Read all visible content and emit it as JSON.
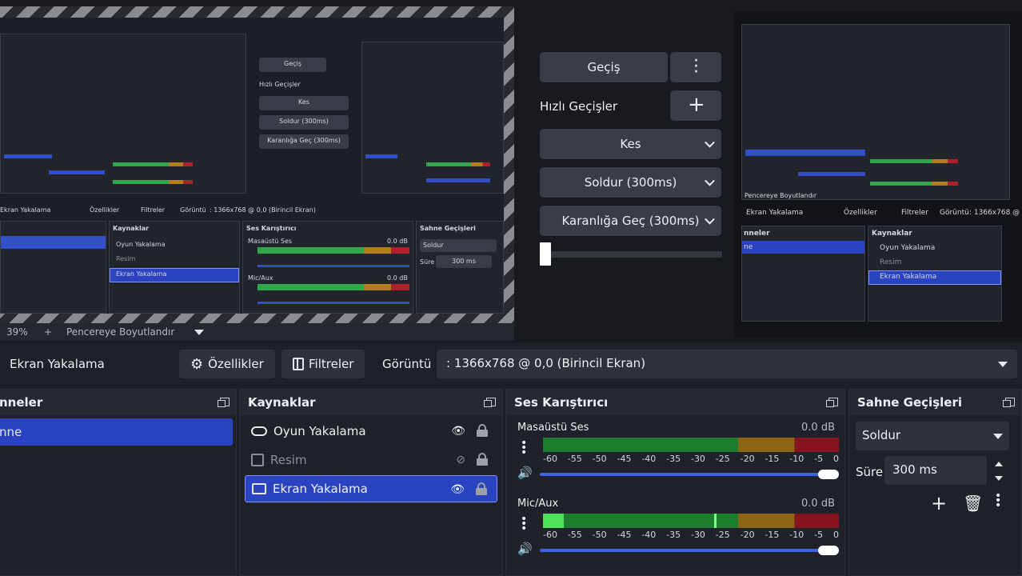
{
  "preview": {
    "zoom_label": "39%",
    "zoom_plus": "+",
    "resize_label": "Pencereye Boyutlandır",
    "mini": {
      "transition_label": "Geçiş",
      "quick_label": "Hızlı Geçişler",
      "cut": "Kes",
      "fade": "Soldur (300ms)",
      "fade_black": "Karanlığa Geç (300ms)",
      "source": "Ekran Yakalama",
      "properties": "Özellikler",
      "filters": "Filtreler",
      "display": "Görüntü",
      "display_value": ": 1366x768 @ 0,0 (Birincil Ekran)",
      "sources_title": "Kaynaklar",
      "mixer_title": "Ses Karıştırıcı",
      "transitions_title": "Sahne Geçişleri",
      "item1": "Oyun Yakalama",
      "item2": "Resim",
      "item3": "Ekran Yakalama",
      "desktop": "Masaüstü Ses",
      "mic": "Mic/Aux",
      "db": "0.0 dB",
      "fade_short": "Soldur",
      "duration": "Süre",
      "duration_value": "300 ms",
      "scenes_title": "nneler",
      "scene": "ne",
      "resize": "Pencereye Boyutlandır"
    }
  },
  "transitions": {
    "transition_button": "Geçiş",
    "menu_icon": "vertical-dots-icon",
    "quick_label": "Hızlı Geçişler",
    "add_icon": "plus-icon",
    "quick": [
      {
        "label": "Kes"
      },
      {
        "label": "Soldur (300ms)"
      },
      {
        "label": "Karanlığa Geç (300ms)"
      }
    ],
    "tbar_position": 0.0
  },
  "context_bar": {
    "source_name": "Ekran Yakalama",
    "properties_label": "Özellikler",
    "filters_label": "Filtreler",
    "display_label": "Görüntü",
    "display_value": ": 1366x768 @ 0,0 (Birincil Ekran)"
  },
  "docks": {
    "scenes": {
      "title": "nneler",
      "items": [
        {
          "label": "nne",
          "selected": true
        }
      ]
    },
    "sources": {
      "title": "Kaynaklar",
      "items": [
        {
          "label": "Oyun Yakalama",
          "icon": "gamepad-icon",
          "visible": true
        },
        {
          "label": "Resim",
          "icon": "image-icon",
          "visible": false
        },
        {
          "label": "Ekran Yakalama",
          "icon": "monitor-icon",
          "visible": true,
          "selected": true
        }
      ]
    },
    "mixer": {
      "title": "Ses Karıştırıcı",
      "channels": [
        {
          "name": "Masaüstü Ses",
          "db": "0.0 dB",
          "level": 0.0,
          "volume": 1.0
        },
        {
          "name": "Mic/Aux",
          "db": "0.0 dB",
          "level": 0.07,
          "peak": 0.58,
          "volume": 1.0
        }
      ],
      "scale": [
        "-60",
        "-55",
        "-50",
        "-45",
        "-40",
        "-35",
        "-30",
        "-25",
        "-20",
        "-15",
        "-10",
        "-5",
        "0"
      ]
    },
    "scene_transitions": {
      "title": "Sahne Geçişleri",
      "selected": "Soldur",
      "duration_label": "Süre",
      "duration_value": "300 ms"
    }
  },
  "colors": {
    "accent_blue": "#2a43c0",
    "meter_green": "#1c7d2f",
    "meter_yellow": "#8c6515",
    "meter_red": "#86141f"
  }
}
